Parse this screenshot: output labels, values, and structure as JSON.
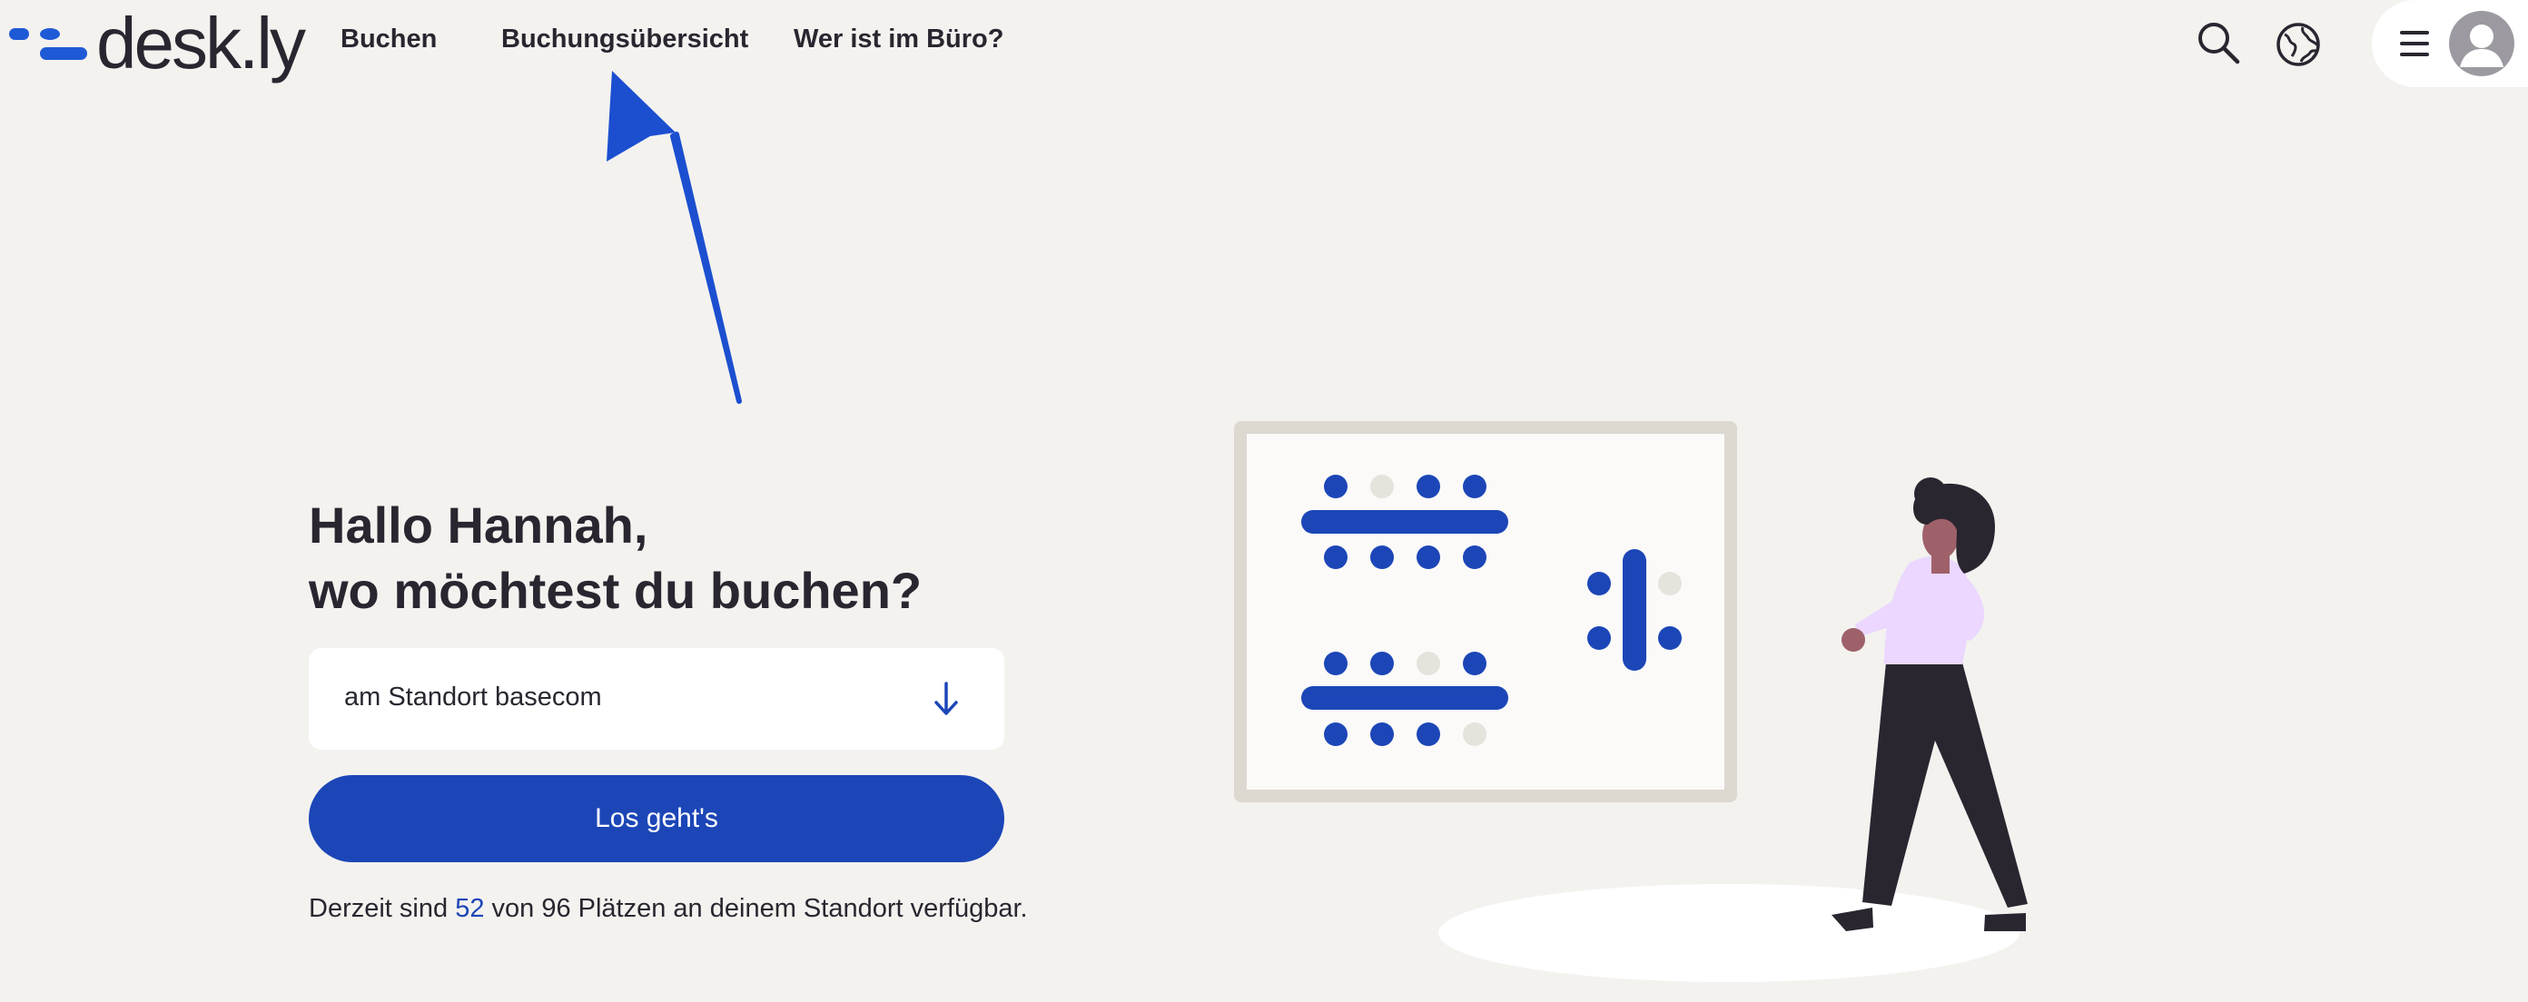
{
  "app": {
    "logo_text": "desk.ly"
  },
  "nav": {
    "items": [
      {
        "label": "Buchen"
      },
      {
        "label": "Buchungsübersicht"
      },
      {
        "label": "Wer ist im Büro?"
      }
    ]
  },
  "header_icons": [
    "search-icon",
    "globe-icon",
    "menu-icon",
    "user-avatar-icon"
  ],
  "greeting": {
    "line1": "Hallo Hannah,",
    "line2": "wo möchtest du buchen?"
  },
  "location": {
    "value": "am Standort basecom",
    "icon": "arrow-down-icon"
  },
  "actions": {
    "go_label": "Los geht's"
  },
  "availability": {
    "prefix": "Derzeit sind",
    "available": "52",
    "suffix": "von 96 Plätzen an deinem Standort verfügbar."
  },
  "colors": {
    "background": "#f3f2ef",
    "primary": "#1c46b7",
    "logo_blue": "#1f5ad6",
    "text": "#2a2630",
    "annotation_arrow": "#1c4fd0"
  }
}
